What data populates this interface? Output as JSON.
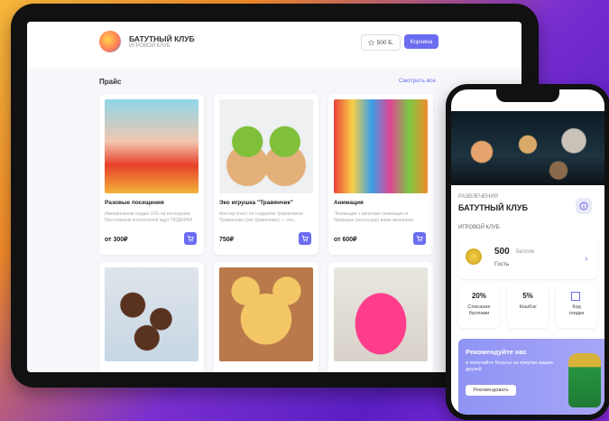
{
  "tablet": {
    "brand_name": "БАТУТНЫЙ КЛУБ",
    "brand_sub": "ИГРОВОЙ КЛУБ",
    "points_label": "500 Б.",
    "cart_label": "Корзина",
    "section_title": "Прайс",
    "see_all": "Смотреть все",
    "cards": [
      {
        "title": "Разовые посещения",
        "desc": "Именинникам скидка 10% на посещение Постоянным посетителей ждут ПОДАРКИ",
        "price": "от 300₽"
      },
      {
        "title": "Эко игрушка \"Травянчик\"",
        "desc": "Мастер класс по созданию травянчиков Травянчики (эко травянчики) — это...",
        "price": "750₽"
      },
      {
        "title": "Анимация",
        "desc": "\"Анимация + включает анимацию и буквацию (аксессуар) ваше вечеринку",
        "price": "от 600₽"
      },
      {
        "title": "",
        "desc": "",
        "price": ""
      },
      {
        "title": "",
        "desc": "",
        "price": ""
      },
      {
        "title": "",
        "desc": "",
        "price": ""
      }
    ]
  },
  "phone": {
    "category": "РАЗВЛЕЧЕНИЯ",
    "title": "БАТУТНЫЙ КЛУБ",
    "subtitle": "ИГРОВОЙ КЛУБ",
    "points_value": "500",
    "points_unit": "баллов",
    "points_status": "Гость",
    "tiles": [
      {
        "value": "20%",
        "label1": "Списание",
        "label2": "баллами"
      },
      {
        "value": "5%",
        "label1": "Кешбэк",
        "label2": ""
      },
      {
        "value": "",
        "label1": "Код",
        "label2": "скидки"
      }
    ],
    "banner_title": "Рекомендуйте нас",
    "banner_text": "и получайте бонусы за покупки ваших друзей",
    "banner_button": "Рекомендовать"
  },
  "colors": {
    "accent": "#6b6cf0",
    "background_orange": "#f28a2b",
    "background_purple": "#7a2fd0"
  }
}
